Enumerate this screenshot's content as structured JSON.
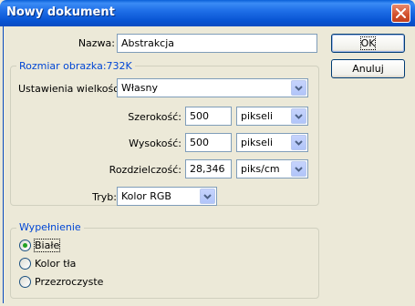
{
  "window": {
    "title": "Nowy dokument"
  },
  "name_field": {
    "label": "Nazwa:",
    "value": "Abstrakcja"
  },
  "buttons": {
    "ok": "OK",
    "cancel": "Anuluj"
  },
  "image_size": {
    "group_title": "Rozmiar obrazka:732K",
    "preset_label": "Ustawienia wielkości:",
    "preset_value": "Własny",
    "width_label": "Szerokość:",
    "width_value": "500",
    "width_unit": "pikseli",
    "height_label": "Wysokość:",
    "height_value": "500",
    "height_unit": "pikseli",
    "resolution_label": "Rozdzielczość:",
    "resolution_value": "28,346",
    "resolution_unit": "piks/cm",
    "mode_label": "Tryb:",
    "mode_value": "Kolor RGB"
  },
  "fill": {
    "group_title": "Wypełnienie",
    "options": [
      "Białe",
      "Kolor tła",
      "Przezroczyste"
    ],
    "selected_index": 0
  },
  "colors": {
    "title_bar": "#0a5fd8",
    "accent_label": "#0046d5",
    "radio_dot": "#21a121"
  }
}
